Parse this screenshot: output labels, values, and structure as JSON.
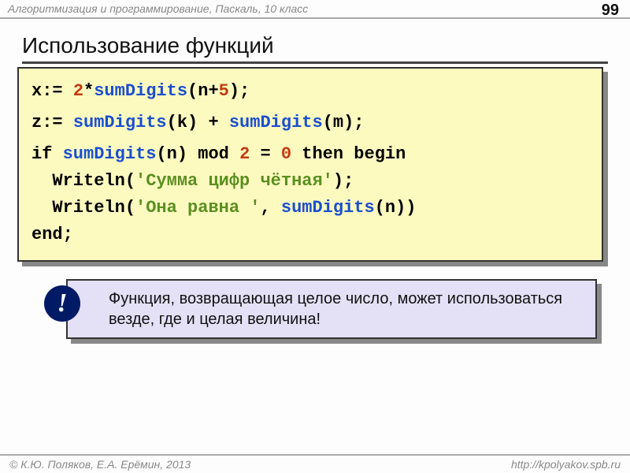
{
  "header": {
    "breadcrumb": "Алгоритмизация и программирование, Паскаль, 10 класс",
    "page_number": "99"
  },
  "heading": "Использование функций",
  "code": {
    "l1_a": "x:= ",
    "l1_num2": "2",
    "l1_b": "*",
    "fn": "sumDigits",
    "l1_c": "(n+",
    "l1_num5": "5",
    "l1_d": ");",
    "l2_a": "z:= ",
    "l2_b": "(k) + ",
    "l2_c": "(m);",
    "l3_a": "if ",
    "l3_b": "(n) mod ",
    "l3_num2": "2",
    "l3_c": " = ",
    "l3_num0": "0",
    "l3_d": " then begin",
    "l4_a": "  Writeln(",
    "l4_str": "'Сумма цифр чётная'",
    "l4_b": ");",
    "l5_a": "  Writeln(",
    "l5_str": "'Она равна '",
    "l5_b": ", ",
    "l5_c": "(n))",
    "l6": "end;"
  },
  "note": {
    "bang": "!",
    "text": "Функция, возвращающая целое число, может использоваться везде, где и целая величина!"
  },
  "footer": {
    "left": "© К.Ю. Поляков, Е.А. Ерёмин, 2013",
    "right": "http://kpolyakov.spb.ru"
  }
}
